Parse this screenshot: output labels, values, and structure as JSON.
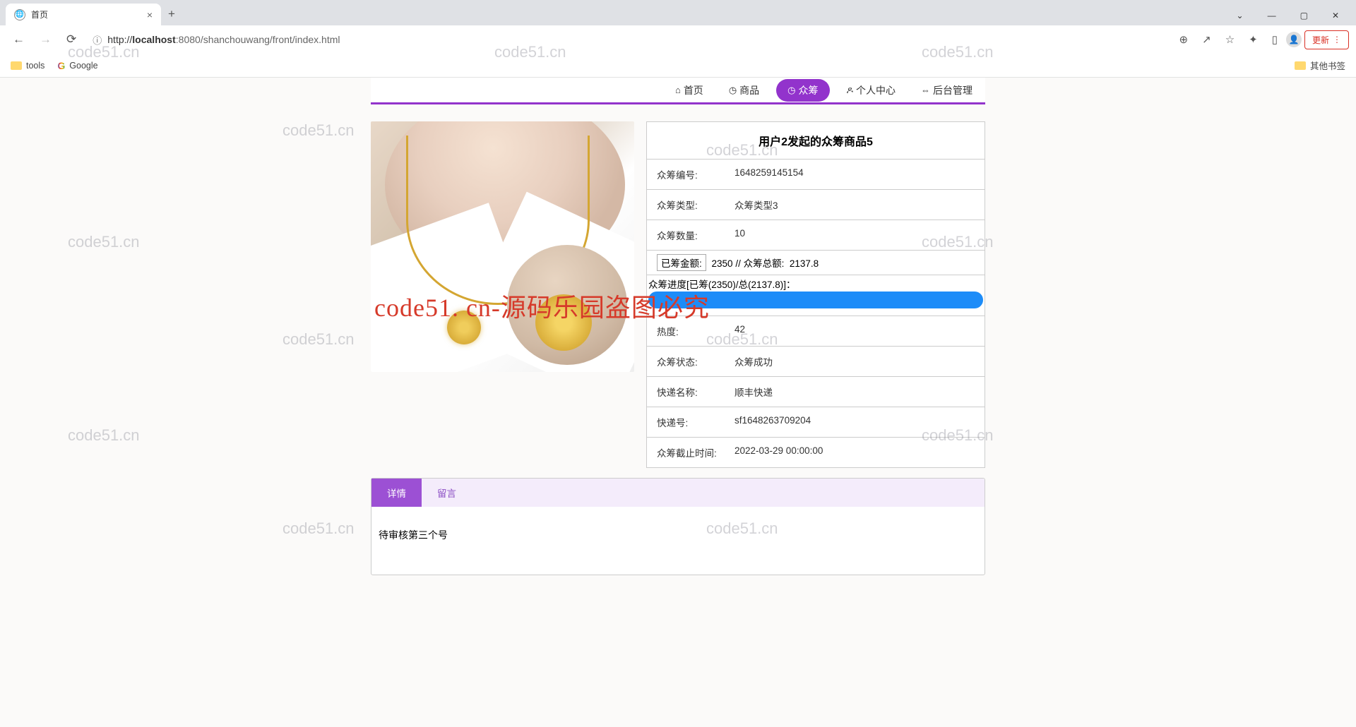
{
  "browser": {
    "tab_title": "首页",
    "address_host": "localhost",
    "address_port": ":8080",
    "address_path": "/shanchouwang/front/index.html",
    "update_btn": "更新"
  },
  "bookmarks": {
    "tools": "tools",
    "google": "Google",
    "other": "其他书签"
  },
  "nav": {
    "home": "首页",
    "product": "商品",
    "crowdfund": "众筹",
    "personal": "个人中心",
    "admin": "后台管理"
  },
  "product": {
    "title": "用户2发起的众筹商品5",
    "rows": {
      "code_label": "众筹编号:",
      "code_value": "1648259145154",
      "type_label": "众筹类型:",
      "type_value": "众筹类型3",
      "qty_label": "众筹数量:",
      "qty_value": "10",
      "raised_label": "已筹金额:",
      "raised_value": "2350",
      "total_sep": "// 众筹总额:",
      "total_value": "2137.8",
      "progress_label": "众筹进度[已筹(2350)/总(2137.8)]：",
      "heat_label": "热度:",
      "heat_value": "42",
      "status_label": "众筹状态:",
      "status_value": "众筹成功",
      "express_label": "快递名称:",
      "express_value": "顺丰快递",
      "track_label": "快递号:",
      "track_value": "sf1648263709204",
      "deadline_label": "众筹截止时间:",
      "deadline_value": "2022-03-29 00:00:00"
    }
  },
  "tabs": {
    "detail": "详情",
    "comment": "留言",
    "content": "待审核第三个号"
  },
  "watermark": "code51.cn",
  "watermark_red": "code51. cn-源码乐园盗图必究"
}
